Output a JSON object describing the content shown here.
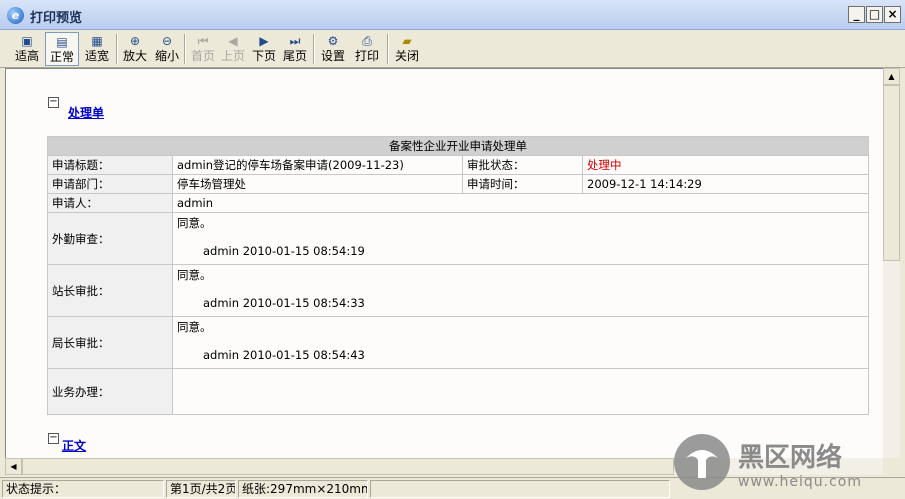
{
  "window": {
    "title": "打印预览",
    "controls": [
      "_",
      "□",
      "×"
    ]
  },
  "toolbar": {
    "buttons": [
      {
        "label": "适高",
        "icon": "fit-height-icon",
        "state": "normal"
      },
      {
        "label": "正常",
        "icon": "normal-size-icon",
        "state": "active"
      },
      {
        "label": "适宽",
        "icon": "fit-width-icon",
        "state": "normal"
      },
      {
        "label": "放大",
        "icon": "zoom-in-icon",
        "state": "normal"
      },
      {
        "label": "缩小",
        "icon": "zoom-out-icon",
        "state": "normal"
      },
      {
        "label": "首页",
        "icon": "first-page-icon",
        "state": "disabled"
      },
      {
        "label": "上页",
        "icon": "prev-page-icon",
        "state": "disabled"
      },
      {
        "label": "下页",
        "icon": "next-page-icon",
        "state": "normal"
      },
      {
        "label": "尾页",
        "icon": "last-page-icon",
        "state": "normal"
      },
      {
        "label": "设置",
        "icon": "settings-icon",
        "state": "normal"
      },
      {
        "label": "打印",
        "icon": "printer-icon",
        "state": "normal"
      },
      {
        "label": "关闭",
        "icon": "close-folder-icon",
        "state": "normal"
      }
    ]
  },
  "document": {
    "section1": {
      "toggle": "−",
      "title": "处理单"
    },
    "form": {
      "caption": "备案性企业开业申请处理单",
      "rows": {
        "subject_label": "申请标题：",
        "subject_value": "admin登记的停车场备案申请(2009-11-23)",
        "status_label": "审批状态：",
        "status_value": "处理中",
        "dept_label": "申请部门：",
        "dept_value": "停车场管理处",
        "time_label": "申请时间：",
        "time_value": "2009-12-1 14:14:29",
        "applicant_label": "申请人：",
        "applicant_value": "admin"
      },
      "reviews": [
        {
          "label": "外勤审查：",
          "text": "同意。",
          "sign": "admin 2010-01-15 08:54:19"
        },
        {
          "label": "站长审批：",
          "text": "同意。",
          "sign": "admin 2010-01-15 08:54:33"
        },
        {
          "label": "局长审批：",
          "text": "同意。",
          "sign": "admin 2010-01-15 08:54:43"
        }
      ],
      "business_label": "业务办理：",
      "business_value": ""
    },
    "section2": {
      "toggle": "−",
      "title": "正文"
    }
  },
  "statusbar": {
    "hint": "状态提示：",
    "page": "第1页/共2页",
    "paper": "纸张:297mm×210mm"
  },
  "watermark": {
    "brand": "黑区网络",
    "url": "www.heiqu.com"
  },
  "colors": {
    "status_red": "#d30000",
    "link_blue": "#0000cc",
    "caption_gray": "#d0d0d0"
  }
}
